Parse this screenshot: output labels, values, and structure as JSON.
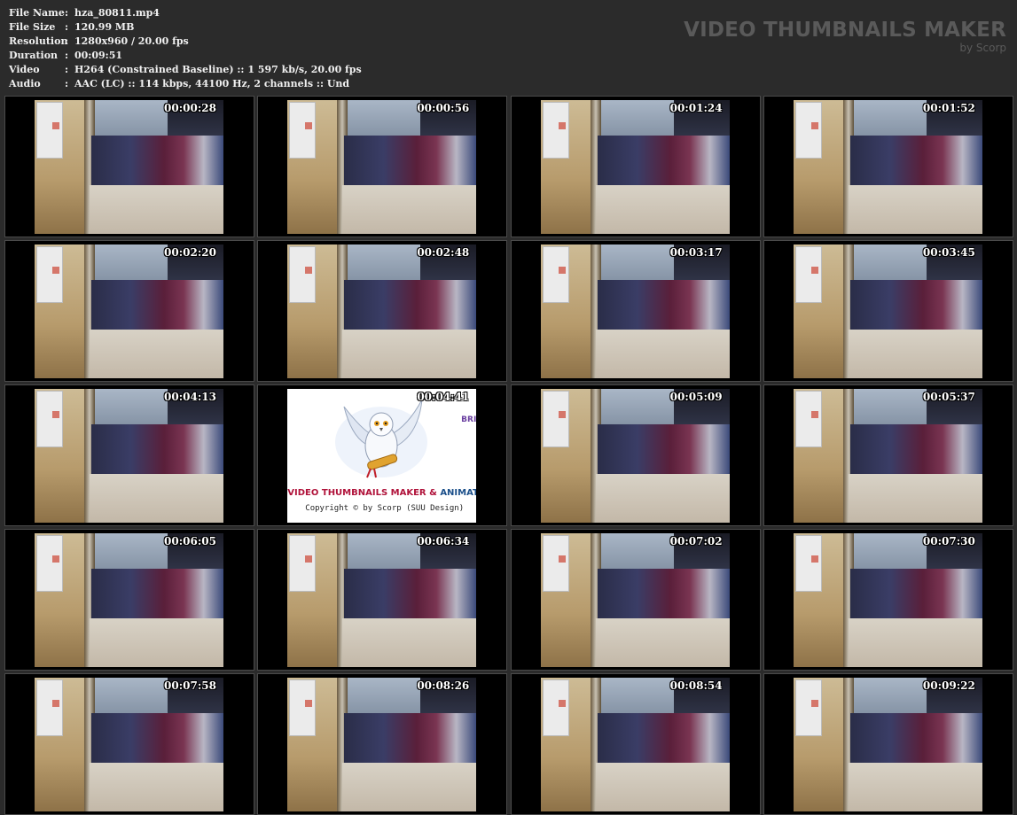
{
  "info": [
    {
      "label": "File Name",
      "value": "hza_80811.mp4"
    },
    {
      "label": "File Size",
      "value": "120.99 MB"
    },
    {
      "label": "Resolution",
      "value": "1280x960 / 20.00 fps"
    },
    {
      "label": "Duration",
      "value": "00:09:51"
    },
    {
      "label": "Video",
      "value": "H264 (Constrained Baseline) :: 1 597 kb/s, 20.00 fps"
    },
    {
      "label": "Audio",
      "value": "AAC (LC) :: 114 kbps, 44100 Hz, 2 channels :: Und"
    }
  ],
  "separator": ":",
  "brand": {
    "title": "VIDEO THUMBNAILS MAKER",
    "subtitle": "by Scorp"
  },
  "thumbnails": [
    "00:00:28",
    "00:00:56",
    "00:01:24",
    "00:01:52",
    "00:02:20",
    "00:02:48",
    "00:03:17",
    "00:03:45",
    "00:04:13",
    "00:04:41",
    "00:05:09",
    "00:05:37",
    "00:06:05",
    "00:06:34",
    "00:07:02",
    "00:07:30",
    "00:07:58",
    "00:08:26",
    "00:08:54",
    "00:09:22"
  ],
  "splash": {
    "index": 9,
    "title_red": "VIDEO THUMBNAILS MAKER",
    "title_amp": " & ",
    "title_blue": "ANIMATO",
    "copyright": "Copyright © by Scorp (SUU Design)",
    "corner": "BRI"
  },
  "colors": {
    "background": "#2b2b2b",
    "info_text": "#f0f0f0",
    "brand_text": "#5a5a5a",
    "splash_red": "#b0123a",
    "splash_blue": "#1b4f8a"
  }
}
